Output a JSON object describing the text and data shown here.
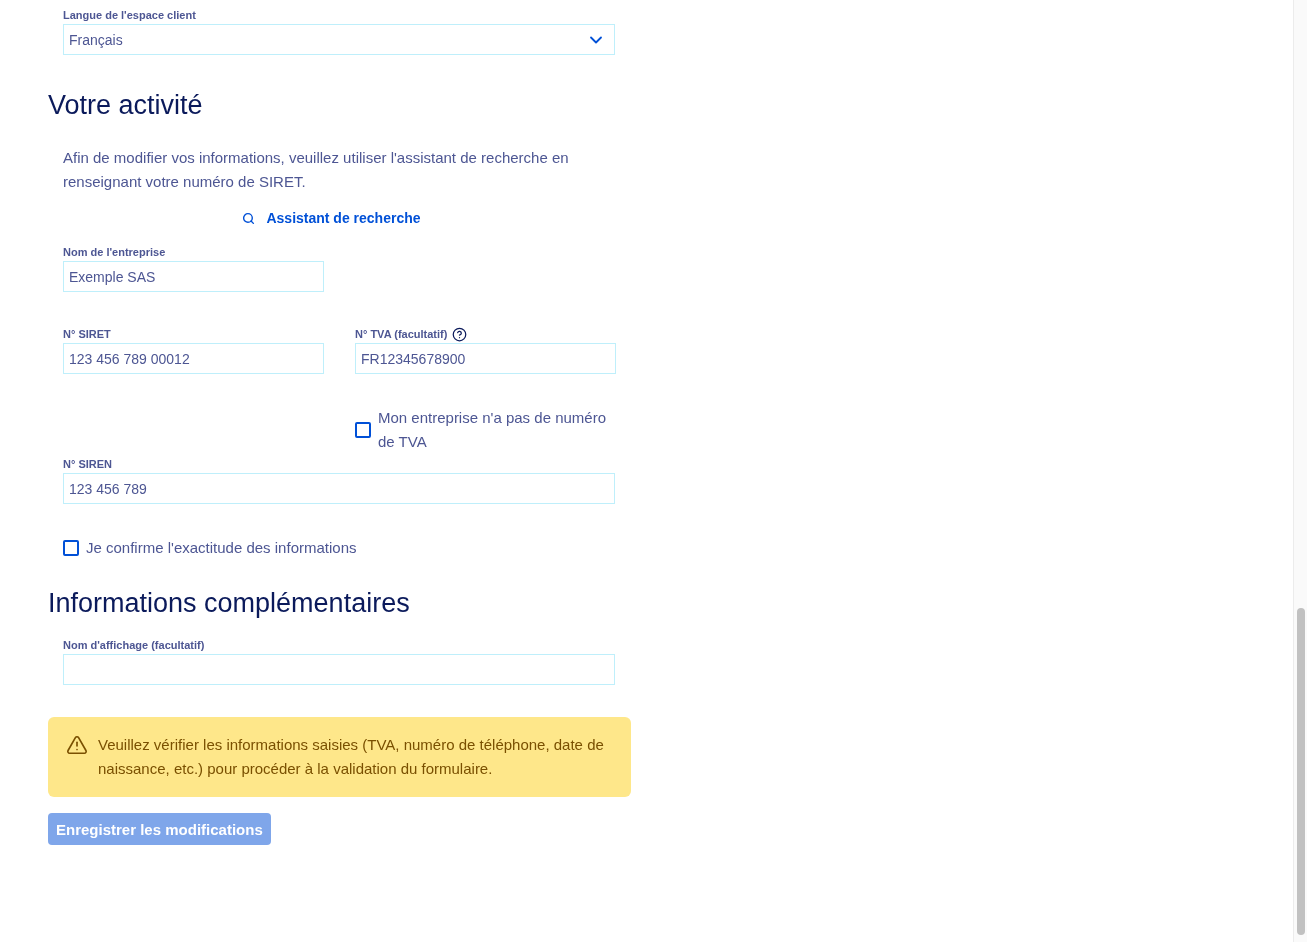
{
  "language": {
    "label": "Langue de l'espace client",
    "value": "Français"
  },
  "activity": {
    "title": "Votre activité",
    "description": "Afin de modifier vos informations, veuillez utiliser l'assistant de recherche en renseignant votre numéro de SIRET.",
    "search_link": "Assistant de recherche",
    "company_name": {
      "label": "Nom de l'entreprise",
      "value": "Exemple SAS"
    },
    "siret": {
      "label": "N° SIRET",
      "value": "123 456 789 00012"
    },
    "vat": {
      "label": "N° TVA (facultatif)",
      "value": "FR12345678900"
    },
    "no_vat": {
      "label": "Mon entreprise n'a pas de numéro de TVA",
      "checked": false
    },
    "siren": {
      "label": "N° SIREN",
      "value": "123 456 789"
    },
    "confirm": {
      "label": "Je confirme l'exactitude des informations",
      "checked": false
    }
  },
  "additional": {
    "title": "Informations complémentaires",
    "display_name": {
      "label": "Nom d'affichage (facultatif)"
    }
  },
  "warning": {
    "text": "Veuillez vérifier les informations saisies (TVA, numéro de téléphone, date de naissance, etc.) pour procéder à la validation du formulaire."
  },
  "save_button": {
    "label": "Enregistrer les modifications",
    "disabled": true
  }
}
